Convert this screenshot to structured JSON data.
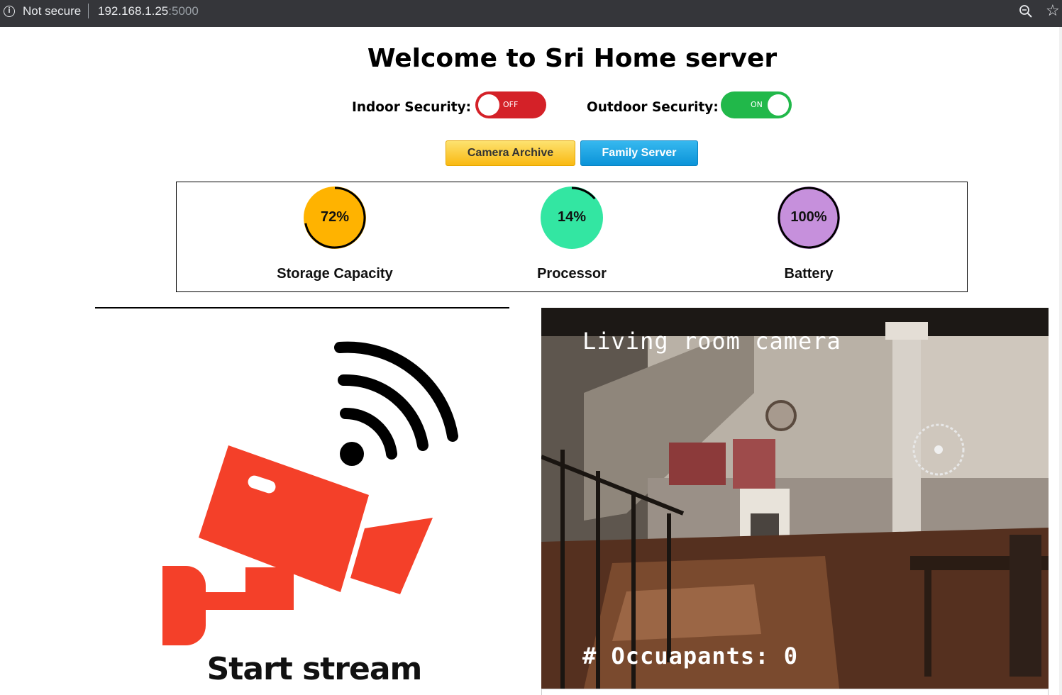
{
  "browser": {
    "security_label": "Not secure",
    "url_host": "192.168.1.25",
    "url_port": ":5000"
  },
  "page": {
    "title": "Welcome to Sri Home server"
  },
  "security": {
    "indoor_label": "Indoor Security:",
    "indoor_state": "OFF",
    "outdoor_label": "Outdoor Security:",
    "outdoor_state": "ON"
  },
  "buttons": {
    "camera_archive": "Camera Archive",
    "family_server": "Family Server"
  },
  "stats": [
    {
      "label": "Storage Capacity",
      "value_text": "72%",
      "value": 72,
      "fill": "#ffb300",
      "ring": "#000000"
    },
    {
      "label": "Processor",
      "value_text": "14%",
      "value": 14,
      "fill": "#33e6a2",
      "ring": "#000000"
    },
    {
      "label": "Battery",
      "value_text": "100%",
      "value": 100,
      "fill": "#c690dc",
      "ring": "#000000"
    }
  ],
  "stream": {
    "label": "Start stream",
    "icon": "security-camera-wifi-icon",
    "color": "#f44029"
  },
  "camera": {
    "title": "Living room camera",
    "occupants": "# Occuapants: 0"
  }
}
